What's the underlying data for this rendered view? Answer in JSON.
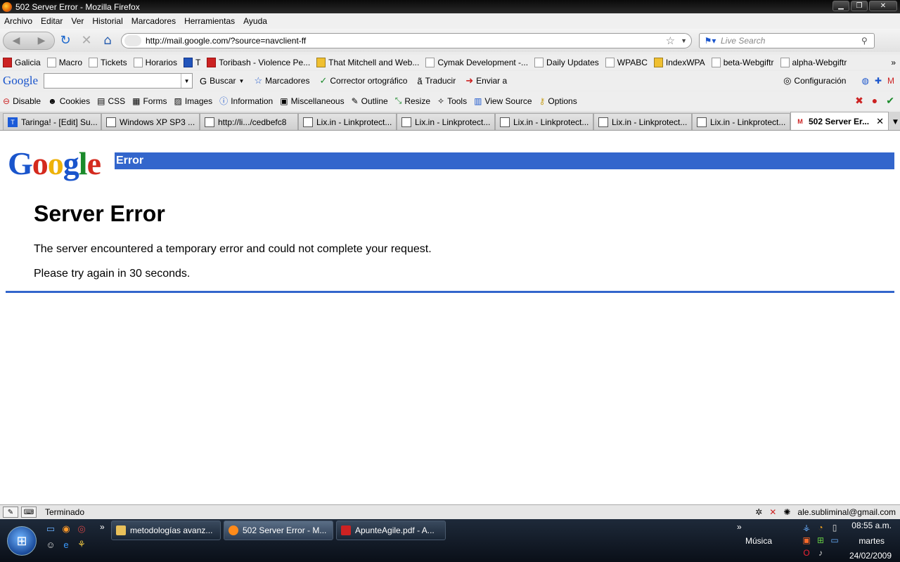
{
  "window": {
    "title": "502 Server Error - Mozilla Firefox"
  },
  "menu": [
    "Archivo",
    "Editar",
    "Ver",
    "Historial",
    "Marcadores",
    "Herramientas",
    "Ayuda"
  ],
  "nav": {
    "url": "http://mail.google.com/?source=navclient-ff",
    "search_placeholder": "Live Search"
  },
  "bookmarks": [
    "Galicia",
    "Macro",
    "Tickets",
    "Horarios",
    "T",
    "Toribash - Violence Pe...",
    "That Mitchell and Web...",
    "Cymak Development -...",
    "Daily Updates",
    "WPABC",
    "IndexWPA",
    "beta-Webgiftr",
    "alpha-Webgiftr"
  ],
  "googlebar": {
    "logo": "Google",
    "buscar": "Buscar",
    "marcadores": "Marcadores",
    "corrector": "Corrector ortográfico",
    "traducir": "Traducir",
    "enviar": "Enviar a",
    "configuracion": "Configuración"
  },
  "webdev": [
    "Disable",
    "Cookies",
    "CSS",
    "Forms",
    "Images",
    "Information",
    "Miscellaneous",
    "Outline",
    "Resize",
    "Tools",
    "View Source",
    "Options"
  ],
  "tabs": [
    "Taringa! - [Edit] Su...",
    "Windows XP SP3 ...",
    "http://li.../cedbefc8",
    "Lix.in - Linkprotect...",
    "Lix.in - Linkprotect...",
    "Lix.in - Linkprotect...",
    "Lix.in - Linkprotect...",
    "Lix.in - Linkprotect...",
    "502 Server Er..."
  ],
  "page": {
    "logo": [
      "G",
      "o",
      "o",
      "g",
      "l",
      "e"
    ],
    "error_label": "Error",
    "heading": "Server Error",
    "message": "The server encountered a temporary error and could not complete your request.",
    "retry": "Please try again in 30 seconds."
  },
  "status": {
    "text": "Terminado",
    "account": "ale.subliminal@gmail.com"
  },
  "taskbar": {
    "buttons": [
      "metodologías avanz...",
      "502 Server Error - M...",
      "ApunteAgile.pdf - A..."
    ],
    "music": "Música",
    "time": "08:55 a.m.",
    "day": "martes",
    "date": "24/02/2009"
  },
  "colors": {
    "google_blue": "#3366cc"
  }
}
